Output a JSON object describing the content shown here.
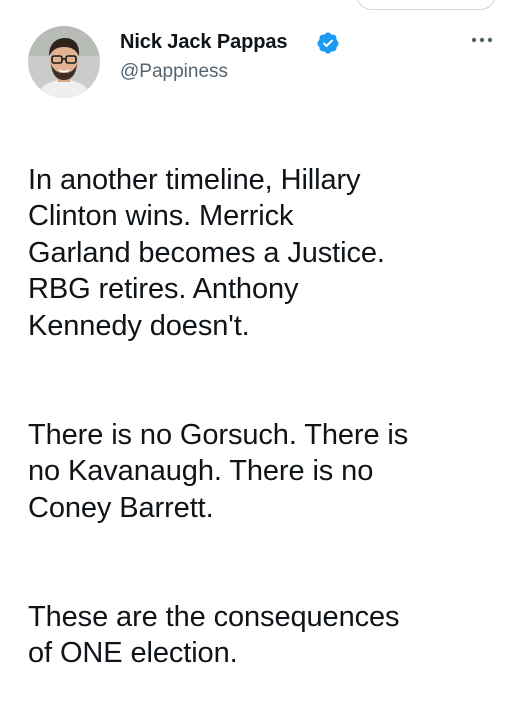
{
  "author": {
    "name": "Nick Jack Pappas",
    "handle": "@Pappiness",
    "verified": true
  },
  "icons": {
    "verified": "verified-badge-icon",
    "more": "more-options-icon"
  },
  "colors": {
    "verified_blue": "#1d9bf0",
    "handle_gray": "#536471",
    "text": "#0f1419"
  },
  "tweet": {
    "paragraphs": [
      "In another timeline, Hillary\nClinton wins. Merrick\nGarland becomes a Justice.\nRBG retires. Anthony\nKennedy doesn't.",
      "There is no Gorsuch. There is\nno Kavanaugh. There is no\nConey Barrett.",
      "These are the consequences\nof ONE election."
    ]
  }
}
